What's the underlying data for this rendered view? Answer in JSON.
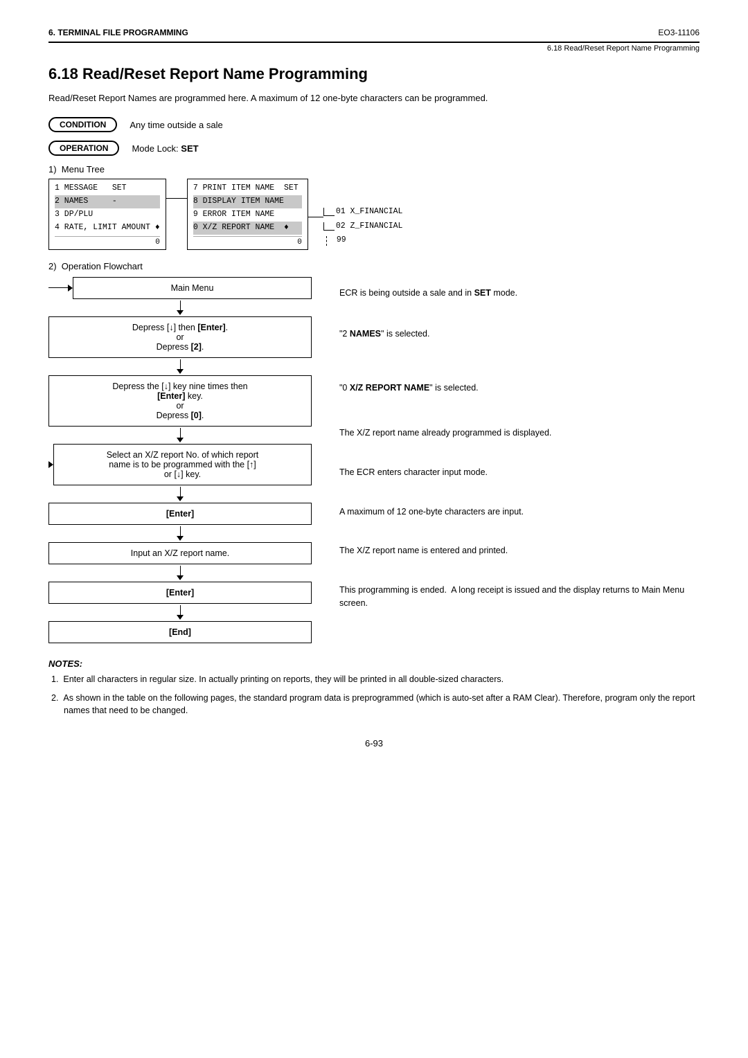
{
  "header": {
    "left": "6.  TERMINAL FILE PROGRAMMING",
    "right": "EO3-11106",
    "sub": "6.18 Read/Reset Report Name Programming"
  },
  "section": {
    "number": "6.18",
    "title": "Read/Reset Report Name Programming",
    "intro": "Read/Reset Report Names are programmed here.  A maximum of 12 one-byte characters can be programmed."
  },
  "condition": {
    "label": "CONDITION",
    "text": "Any time outside a sale"
  },
  "operation": {
    "label": "OPERATION",
    "text": "Mode Lock: ",
    "bold": "SET"
  },
  "menu_tree": {
    "title": "Menu Tree",
    "left_col": [
      {
        "num": "1",
        "name": "MESSAGE",
        "suffix": "   SET"
      },
      {
        "num": "2",
        "name": "NAMES",
        "suffix": "   -",
        "highlight": true
      },
      {
        "num": "3",
        "name": "DP/PLU",
        "suffix": ""
      },
      {
        "num": "4",
        "name": "RATE, LIMIT AMOUNT",
        "suffix": " ♦"
      }
    ],
    "left_bottom": "0",
    "right_col": [
      {
        "num": "7",
        "name": "PRINT ITEM NAME",
        "suffix": "  SET"
      },
      {
        "num": "8",
        "name": "DISPLAY ITEM NAME",
        "suffix": "",
        "highlight": true
      },
      {
        "num": "9",
        "name": "ERROR ITEM NAME",
        "suffix": ""
      },
      {
        "num": "0",
        "name": "X/Z REPORT NAME",
        "suffix": " ♦",
        "highlight": true
      }
    ],
    "right_bottom": "0",
    "branches": [
      "01 X_FINANCIAL",
      "02 Z_FINANCIAL",
      "99"
    ]
  },
  "flowchart": {
    "title": "Operation Flowchart",
    "steps": [
      {
        "id": "main_menu",
        "label": "Main Menu",
        "note": "ECR is being outside a sale and in SET mode."
      },
      {
        "id": "step1",
        "label": "Depress [↓] then [Enter].\nor\nDepress [2].",
        "note": "\"2 NAMES\" is selected."
      },
      {
        "id": "step2",
        "label": "Depress the [↓] key nine times then\n[Enter] key.\nor\nDepress [0].",
        "note": "\"0 X/Z REPORT NAME\" is selected."
      },
      {
        "id": "step3",
        "label": "Select an X/Z report No. of which report\nname is to be programmed with the [↑]\nor [↓] key.",
        "note": "The X/Z report name already programmed is displayed."
      },
      {
        "id": "step4",
        "label": "[Enter]",
        "bold": true,
        "note": "The ECR enters character input mode."
      },
      {
        "id": "step5",
        "label": "Input an X/Z report name.",
        "note": "A maximum of 12 one-byte characters are input."
      },
      {
        "id": "step6",
        "label": "[Enter]",
        "bold": true,
        "note": "The X/Z report name is entered and printed."
      },
      {
        "id": "step7",
        "label": "[End]",
        "bold": true,
        "note": "This programming is ended.  A long receipt is issued and the display returns to Main Menu screen."
      }
    ]
  },
  "notes": {
    "title": "NOTES:",
    "items": [
      "Enter all characters in regular size. In actually printing on reports, they will be printed in all double-sized characters.",
      "As shown in the table on the following pages, the standard program data is preprogrammed (which is auto-set after a RAM Clear). Therefore, program only the report names that need to be changed."
    ]
  },
  "page_number": "6-93"
}
